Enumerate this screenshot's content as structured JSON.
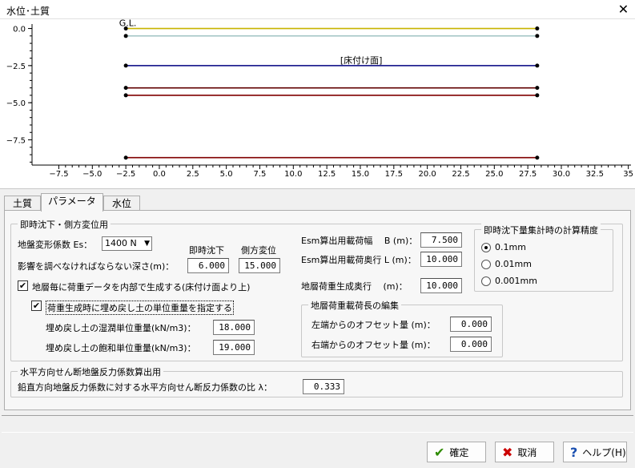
{
  "window": {
    "title": "水位･土質",
    "close_glyph": "✕"
  },
  "chart_data": {
    "type": "line",
    "title": "",
    "xlabel": "",
    "ylabel": "",
    "x_ticks": [
      -7.5,
      -5.0,
      -2.5,
      0.0,
      2.5,
      5.0,
      7.5,
      10.0,
      12.5,
      15.0,
      17.5,
      20.0,
      22.5,
      25.0,
      27.5,
      30.0,
      32.5,
      35
    ],
    "x_tick_labels": [
      "−7.5",
      "−5.0",
      "−2.5",
      "0.0",
      "2.5",
      "5.0",
      "7.5",
      "10.0",
      "12.5",
      "15.0",
      "17.5",
      "20.0",
      "22.5",
      "25.0",
      "27.5",
      "30.0",
      "32.5",
      "35"
    ],
    "y_ticks": [
      0.0,
      -2.5,
      -5.0,
      -7.5
    ],
    "y_tick_labels": [
      "0.0",
      "−2.5",
      "−5.0",
      "−7.5"
    ],
    "xlim": [
      -9.5,
      35.2
    ],
    "ylim": [
      -9.2,
      0.3
    ],
    "grid": false,
    "series": [
      {
        "x": [
          -2.5,
          28.2
        ],
        "y": [
          0.0,
          0.0
        ],
        "color": "#c8b400"
      },
      {
        "x": [
          -2.5,
          28.2
        ],
        "y": [
          -0.5,
          -0.5
        ],
        "color": "#a8c8c8"
      },
      {
        "x": [
          -2.5,
          28.2
        ],
        "y": [
          -2.5,
          -2.5
        ],
        "color": "#000080"
      },
      {
        "x": [
          -2.5,
          28.2
        ],
        "y": [
          -4.0,
          -4.0
        ],
        "color": "#600000"
      },
      {
        "x": [
          -2.5,
          28.2
        ],
        "y": [
          -4.5,
          -4.5
        ],
        "color": "#800000"
      },
      {
        "x": [
          -2.5,
          28.2
        ],
        "y": [
          -8.7,
          -8.7
        ],
        "color": "#800000"
      }
    ],
    "annotations": [
      {
        "text": "G.L.",
        "x": -3.0,
        "y": 0.0
      },
      {
        "text": "[床付け面]",
        "x": 13.5,
        "y": -2.5
      }
    ]
  },
  "tabs": [
    {
      "label": "土質",
      "active": false
    },
    {
      "label": "パラメータ",
      "active": true
    },
    {
      "label": "水位",
      "active": false
    }
  ],
  "group_immediate": {
    "legend": "即時沈下・側方変位用",
    "es_label": "地盤変形係数 Es：",
    "es_value": "1400 N",
    "col_immediate": "即時沈下",
    "col_lateral": "側方変位",
    "depth_label": "影響を調べなければならない深さ(m)：",
    "depth_immediate": "6.000",
    "depth_lateral": "15.000",
    "gen_load_label": "地層毎に荷重データを内部で生成する(床付け面より上)",
    "gen_load_checked": true,
    "specify_unit_label": "荷重生成時に埋め戻し土の単位重量を指定する",
    "specify_unit_checked": true,
    "wet_label": "埋め戻し土の湿潤単位重量(kN/m3)：",
    "wet_value": "18.000",
    "sat_label": "埋め戻し土の飽和単位重量(kN/m3)：",
    "sat_value": "19.000",
    "esm_width_label": "Esm算出用載荷幅　 B (m)：",
    "esm_width_value": "7.500",
    "esm_depth_label": "Esm算出用載荷奥行 L (m)：",
    "esm_depth_value": "10.000",
    "layer_depth_label": "地層荷重生成奥行　 (m)：",
    "layer_depth_value": "10.000"
  },
  "group_precision": {
    "legend": "即時沈下量集計時の計算精度",
    "options": [
      {
        "label": "0.1mm",
        "selected": true
      },
      {
        "label": "0.01mm",
        "selected": false
      },
      {
        "label": "0.001mm",
        "selected": false
      }
    ]
  },
  "group_layer_load": {
    "legend": "地層荷重載荷長の編集",
    "left_label": "左端からのオフセット量 (m)：",
    "left_value": "0.000",
    "right_label": "右端からのオフセット量 (m)：",
    "right_value": "0.000"
  },
  "group_horizontal": {
    "legend": "水平方向せん断地盤反力係数算出用",
    "ratio_label": "鉛直方向地盤反力係数に対する水平方向せん断反力係数の比 λ：",
    "ratio_value": "0.333"
  },
  "buttons": {
    "ok": "確定",
    "cancel": "取消",
    "help": "ヘルプ(H)"
  },
  "colors": {
    "ok_icon": "#2e8b00",
    "cancel_icon": "#cc0000",
    "help_icon": "#1a4fb0"
  }
}
